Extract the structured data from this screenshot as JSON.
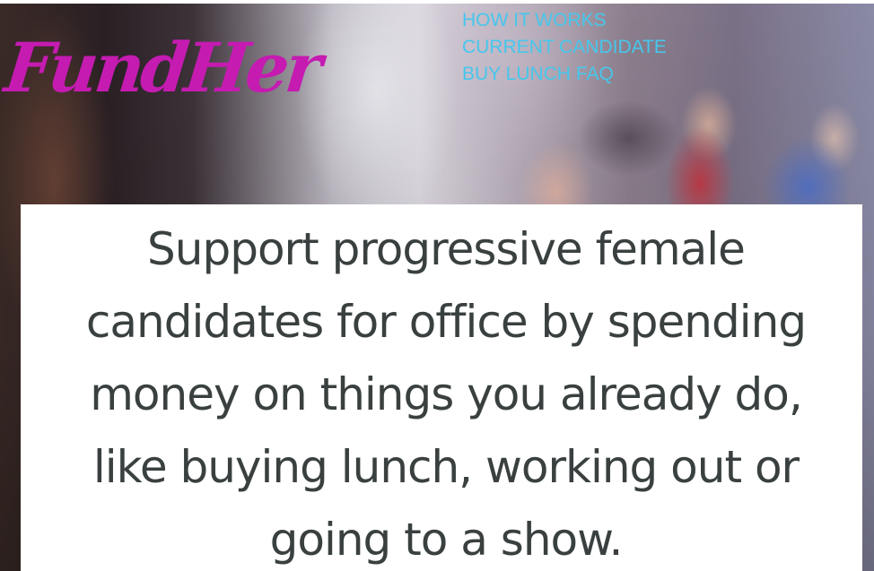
{
  "brand": {
    "logo_text": "FundHer",
    "logo_color": "#c51bb1"
  },
  "nav": {
    "color": "#46c7ec",
    "items": [
      {
        "label": "HOW IT WORKS"
      },
      {
        "label": "CURRENT CANDIDATE"
      },
      {
        "label": "BUY LUNCH"
      },
      {
        "label": "FAQ"
      }
    ]
  },
  "hero": {
    "tagline_lines": [
      "Support progressive female",
      "candidates for office by spending",
      "money on things you already do,",
      "like buying lunch, working out or",
      "going to a show."
    ],
    "text_color": "#3a4040"
  }
}
